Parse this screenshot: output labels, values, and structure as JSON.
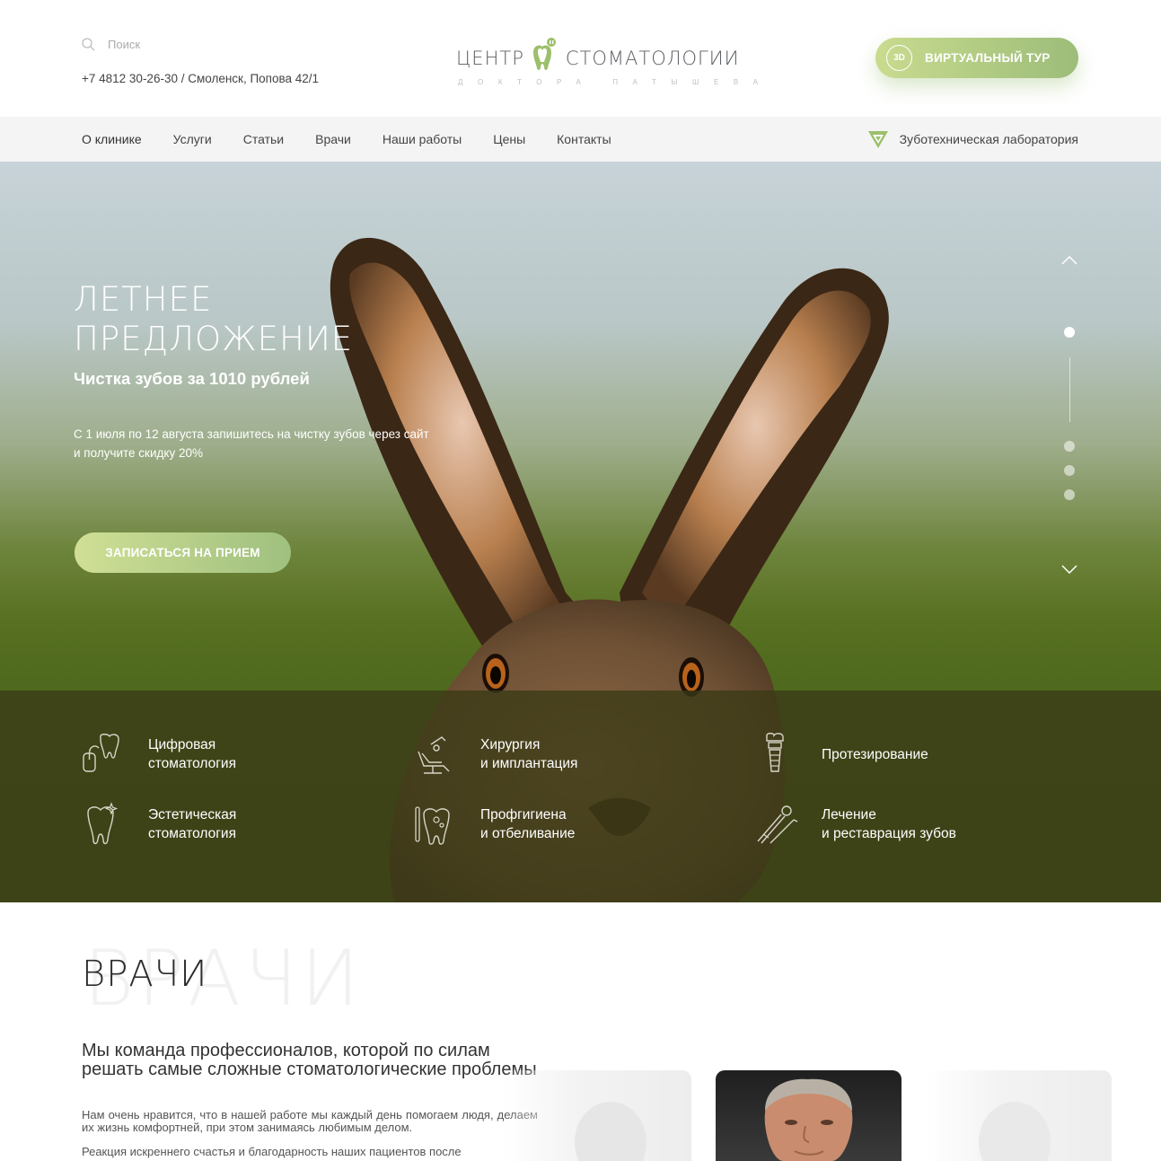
{
  "header": {
    "search_placeholder": "Поиск",
    "contacts": "+7 4812 30-26-30 / Смоленск, Попова 42/1",
    "logo": {
      "word1": "ЦЕНТР",
      "word2": "СТОМАТОЛОГИИ",
      "subtitle": "ДОКТОРА ПАТЫШЕВА",
      "accent_color": "#9cbf6b"
    },
    "tour_button": {
      "badge": "3D",
      "label": "ВИРТУАЛЬНЫЙ ТУР"
    }
  },
  "nav": {
    "items": [
      {
        "label": "О клинике"
      },
      {
        "label": "Услуги"
      },
      {
        "label": "Статьи"
      },
      {
        "label": "Врачи"
      },
      {
        "label": "Наши работы"
      },
      {
        "label": "Цены"
      },
      {
        "label": "Контакты"
      }
    ],
    "lab_link": "Зуботехническая лаборатория"
  },
  "hero": {
    "title_line1": "ЛЕТНЕЕ",
    "title_line2": "ПРЕДЛОЖЕНИЕ",
    "subtitle": "Чистка зубов за 1010 рублей",
    "text": "С 1 июля по 12 августа запишитесь на чистку зубов через сайт и получите скидку 20%",
    "cta": "ЗАПИСАТЬСЯ НА ПРИЕМ",
    "slider": {
      "total": 4,
      "active": 1
    }
  },
  "services": [
    {
      "label": "Цифровая\nстоматология",
      "icon": "digital-tooth-icon"
    },
    {
      "label": "Хирургия\nи имплантация",
      "icon": "dental-chair-icon"
    },
    {
      "label": "Протезирование",
      "icon": "implant-icon"
    },
    {
      "label": "Эстетическая\nстоматология",
      "icon": "sparkle-tooth-icon"
    },
    {
      "label": "Профгигиена\nи отбеливание",
      "icon": "hygiene-tooth-icon"
    },
    {
      "label": "Лечение\nи реставрация зубов",
      "icon": "dental-tools-icon"
    }
  ],
  "doctors": {
    "bg_title": "ВРАЧИ",
    "title": "ВРАЧИ",
    "lead": "Мы команда профессионалов, которой по силам решать самые сложные стоматологические проблемы",
    "p1": "Нам очень нравится, что в нашей работе мы каждый день помогаем людя, делаем их жизнь комфортней, при этом занимаясь любимым делом.",
    "p2": "Реакция искреннего счастья и благодарность наших пациентов после"
  },
  "colors": {
    "accent_green": "#9cbd79",
    "accent_light": "#c9db8f",
    "text_dark": "#2c2c2c",
    "nav_bg": "#f4f4f4"
  }
}
